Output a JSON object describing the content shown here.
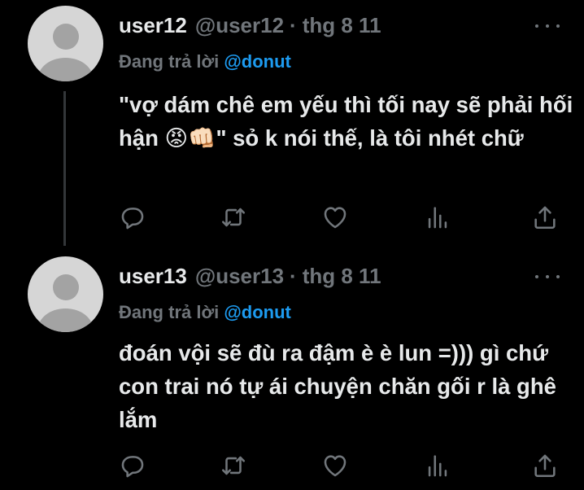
{
  "tweets": [
    {
      "name": "user12",
      "handle": "@user12",
      "separator": "·",
      "date": "thg 8 11",
      "replying_prefix": "Đang trả lời",
      "replying_to": "@donut",
      "text": "\"vợ dám chê em yếu thì tối nay sẽ phải hối hận 😡👊🏻\" sỏ k nói thế, là tôi nhét chữ"
    },
    {
      "name": "user13",
      "handle": "@user13",
      "separator": "·",
      "date": "thg 8 11",
      "replying_prefix": "Đang trả lời",
      "replying_to": "@donut",
      "text": "đoán vội sẽ đù ra đậm è è lun =))) gì chứ con trai nó tự ái chuyện chăn gối r là ghê lắm"
    }
  ],
  "colors": {
    "background": "#000000",
    "primary_text": "#e7e9ea",
    "secondary_text": "#71767b",
    "accent": "#1d9bf0",
    "thread_line": "#333639"
  },
  "icons": [
    "reply-icon",
    "retweet-icon",
    "like-icon",
    "views-icon",
    "share-icon",
    "more-icon"
  ]
}
